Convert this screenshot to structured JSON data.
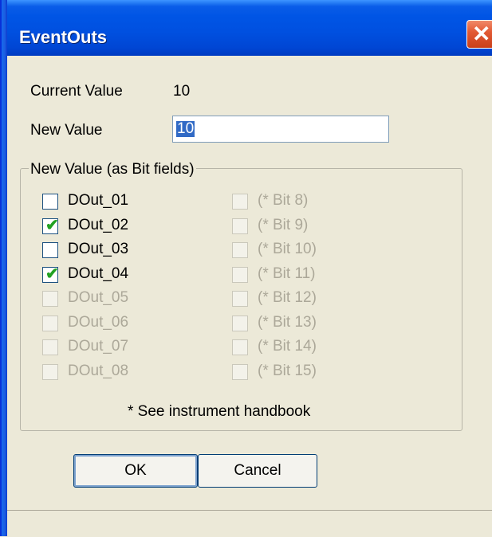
{
  "window": {
    "title": "EventOuts",
    "close_glyph": "✕"
  },
  "form": {
    "current_value_label": "Current Value",
    "current_value": "10",
    "new_value_label": "New Value",
    "new_value_input": "10"
  },
  "group": {
    "title": "New Value (as Bit fields)",
    "left_bits": [
      {
        "label": "DOut_01",
        "checked": false,
        "enabled": true
      },
      {
        "label": "DOut_02",
        "checked": true,
        "enabled": true
      },
      {
        "label": "DOut_03",
        "checked": false,
        "enabled": true
      },
      {
        "label": "DOut_04",
        "checked": true,
        "enabled": true
      },
      {
        "label": "DOut_05",
        "checked": false,
        "enabled": false
      },
      {
        "label": "DOut_06",
        "checked": false,
        "enabled": false
      },
      {
        "label": "DOut_07",
        "checked": false,
        "enabled": false
      },
      {
        "label": "DOut_08",
        "checked": false,
        "enabled": false
      }
    ],
    "right_bits": [
      {
        "label": "(* Bit 8)",
        "checked": false,
        "enabled": false
      },
      {
        "label": "(* Bit 9)",
        "checked": false,
        "enabled": false
      },
      {
        "label": "(* Bit 10)",
        "checked": false,
        "enabled": false
      },
      {
        "label": "(* Bit 11)",
        "checked": false,
        "enabled": false
      },
      {
        "label": "(* Bit 12)",
        "checked": false,
        "enabled": false
      },
      {
        "label": "(* Bit 13)",
        "checked": false,
        "enabled": false
      },
      {
        "label": "(* Bit 14)",
        "checked": false,
        "enabled": false
      },
      {
        "label": "(* Bit 15)",
        "checked": false,
        "enabled": false
      }
    ],
    "note": "* See instrument handbook"
  },
  "buttons": {
    "ok_label": "OK",
    "cancel_label": "Cancel"
  },
  "colors": {
    "titlebar": "#0055e5",
    "dialog_bg": "#ece9d8",
    "check": "#21a121",
    "selection": "#316ac5"
  }
}
